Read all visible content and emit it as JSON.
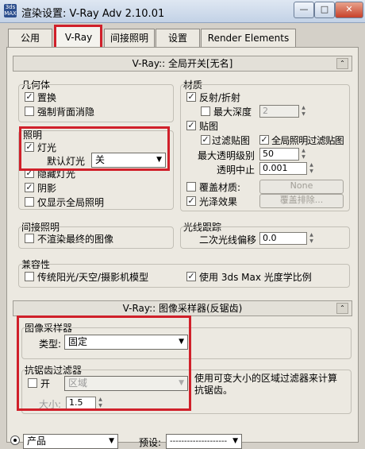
{
  "window": {
    "title": "渲染设置: V-Ray Adv 2.10.01",
    "icon_text": "3ds MAX",
    "buttons": {
      "minimize": "—",
      "maximize": "□",
      "close": "✕"
    }
  },
  "tabs": [
    {
      "label": "公用"
    },
    {
      "label": "V-Ray",
      "active": true
    },
    {
      "label": "间接照明"
    },
    {
      "label": "设置"
    },
    {
      "label": "Render Elements"
    }
  ],
  "global_switches": {
    "header": "V-Ray:: 全局开关[无名]",
    "geometry": {
      "title": "几何体",
      "displacement": {
        "label": "置换",
        "checked": true
      },
      "force_backface": {
        "label": "强制背面消隐",
        "checked": false
      }
    },
    "lighting": {
      "title": "照明",
      "lights": {
        "label": "灯光",
        "checked": true
      },
      "default_lights_label": "默认灯光",
      "default_lights_value": "关",
      "hidden_lights": {
        "label": "隐藏灯光",
        "checked": true
      },
      "shadows": {
        "label": "阴影",
        "checked": true
      },
      "show_gi_only": {
        "label": "仅显示全局照明",
        "checked": false
      }
    },
    "materials": {
      "title": "材质",
      "reflection": {
        "label": "反射/折射",
        "checked": true
      },
      "max_depth": {
        "label": "最大深度",
        "checked": false,
        "value": "2"
      },
      "maps": {
        "label": "贴图",
        "checked": true
      },
      "filter_maps": {
        "label": "过滤贴图",
        "checked": true
      },
      "filter_maps_gi": {
        "label": "全局照明过滤贴图",
        "checked": true
      },
      "max_transp_label": "最大透明级别",
      "max_transp_value": "50",
      "transp_cutoff_label": "透明中止",
      "transp_cutoff_value": "0.001",
      "override_mtl": {
        "label": "覆盖材质:",
        "checked": false,
        "button": "None"
      },
      "glossy": {
        "label": "光泽效果",
        "checked": true,
        "button": "覆盖排除..."
      }
    },
    "indirect": {
      "title": "间接照明",
      "dont_render_final": {
        "label": "不渲染最终的图像",
        "checked": false
      }
    },
    "raytracing": {
      "title": "光线跟踪",
      "secondary_bias_label": "二次光线偏移",
      "secondary_bias_value": "0.0"
    },
    "compatibility": {
      "title": "兼容性",
      "legacy_sun": {
        "label": "传统阳光/天空/摄影机模型",
        "checked": false
      },
      "photometric": {
        "label": "使用 3ds Max 光度学比例",
        "checked": true
      }
    }
  },
  "image_sampler": {
    "header": "V-Ray:: 图像采样器(反锯齿)",
    "sampler_title": "图像采样器",
    "type_label": "类型:",
    "type_value": "固定",
    "aa_title": "抗锯齿过滤器",
    "aa_on": {
      "label": "开",
      "checked": false
    },
    "filter_value": "区域",
    "filter_desc": "使用可变大小的区域过滤器来计算抗锯齿。",
    "size_label": "大小:",
    "size_value": "1.5"
  },
  "bottom_bar": {
    "mode_value": "产品",
    "preset_label": "预设:",
    "preset_value": "--------------------"
  },
  "colors": {
    "highlight_red": "#d0202a",
    "panel_bg": "#ece9e1"
  }
}
